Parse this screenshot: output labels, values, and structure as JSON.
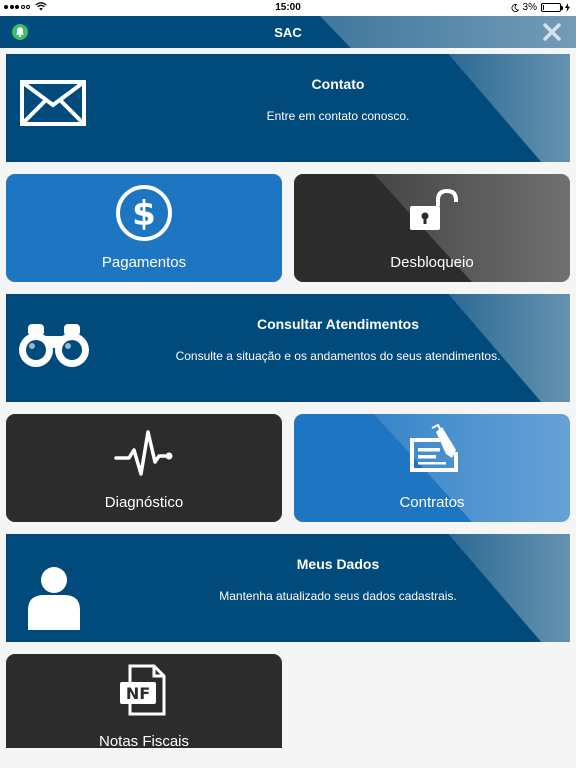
{
  "status_bar": {
    "time": "15:00",
    "battery": "3%",
    "battery_level": 0.03
  },
  "nav": {
    "title": "SAC",
    "left_icon": "bell-icon",
    "right_icon": "close-icon"
  },
  "cards": {
    "contato": {
      "title": "Contato",
      "description": "Entre em contato conosco.",
      "icon": "envelope-icon"
    },
    "pagamentos": {
      "label": "Pagamentos",
      "icon": "dollar-icon"
    },
    "desbloqueio": {
      "label": "Desbloqueio",
      "icon": "unlock-icon"
    },
    "consultar": {
      "title": "Consultar Atendimentos",
      "description": "Consulte a situação e os andamentos do seus atendimentos.",
      "icon": "binoculars-icon"
    },
    "diagnostico": {
      "label": "Diagnóstico",
      "icon": "pulse-icon"
    },
    "contratos": {
      "label": "Contratos",
      "icon": "contract-icon"
    },
    "meus_dados": {
      "title": "Meus Dados",
      "description": "Mantenha atualizado seus dados cadastrais.",
      "icon": "user-icon"
    },
    "notas_fiscais": {
      "label": "Notas Fiscais",
      "icon": "nf-document-icon",
      "icon_text": "NF"
    }
  },
  "colors": {
    "primary": "#004a7c",
    "tile_blue": "#1e75c2",
    "tile_dark": "#2c2c2c",
    "bell_green": "#3bbf6a"
  }
}
